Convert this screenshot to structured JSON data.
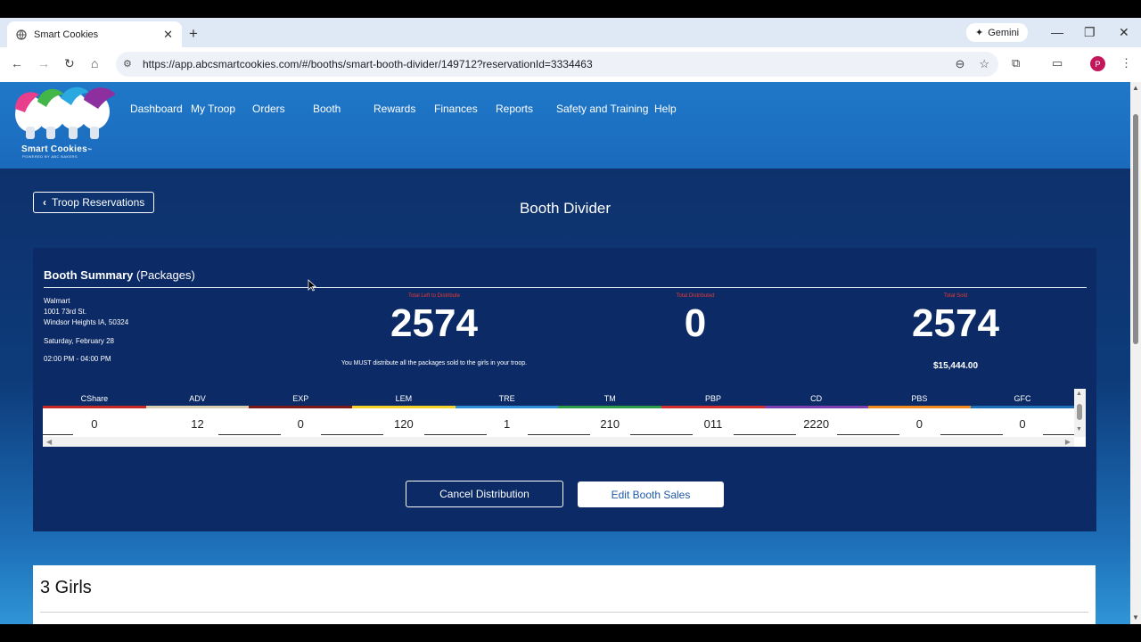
{
  "browser": {
    "tab_title": "Smart Cookies",
    "tab_close": "✕",
    "new_tab": "+",
    "gemini_label": "Gemini",
    "url": "https://app.abcsmartcookies.com/#/booths/smart-booth-divider/149712?reservationId=3334463",
    "avatar_letter": "P",
    "window_controls": [
      "—",
      "❐",
      "✕"
    ]
  },
  "site": {
    "logo_text": "Smart Cookies",
    "logo_tm": "™",
    "logo_sub": "POWERED BY ABC BAKERS",
    "nav": [
      "Dashboard",
      "My Troop",
      "Orders",
      "Booth",
      "Rewards",
      "Finances",
      "Reports",
      "Safety and Training",
      "Help"
    ]
  },
  "page": {
    "back_button": "Troop Reservations",
    "title": "Booth Divider"
  },
  "summary": {
    "title_bold": "Booth Summary",
    "title_rest": "(Packages)",
    "location_name": "Walmart",
    "street": "1001 73rd St.",
    "city": "Windsor Heights IA, 50324",
    "date": "Saturday, February 28",
    "time": "02:00 PM - 04:00 PM",
    "stats": [
      {
        "label": "Total Left to Distribute",
        "value": "2574"
      },
      {
        "label": "Total Distributed",
        "value": "0"
      },
      {
        "label": "Total Sold",
        "value": "2574"
      }
    ],
    "distribute_note": "You MUST distribute all the packages sold to the girls in your troop.",
    "total_amount": "$15,444.00"
  },
  "cookies": {
    "columns": [
      {
        "code": "CShare",
        "value": "0",
        "color": "#c62828"
      },
      {
        "code": "ADV",
        "value": "12",
        "color": "#d9cdb0"
      },
      {
        "code": "EXP",
        "value": "0",
        "color": "#7b1a1a"
      },
      {
        "code": "LEM",
        "value": "120",
        "color": "#f2d12b"
      },
      {
        "code": "TRE",
        "value": "1",
        "color": "#2f8fd8"
      },
      {
        "code": "TM",
        "value": "210",
        "color": "#2e9b49"
      },
      {
        "code": "PBP",
        "value": "011",
        "color": "#d32f2f"
      },
      {
        "code": "CD",
        "value": "2220",
        "color": "#7b3fb0"
      },
      {
        "code": "PBS",
        "value": "0",
        "color": "#f08a1c"
      },
      {
        "code": "GFC",
        "value": "0",
        "color": "#1d6fb8"
      }
    ]
  },
  "actions": {
    "cancel": "Cancel Distribution",
    "edit": "Edit Booth Sales"
  },
  "girls": {
    "title": "3 Girls"
  }
}
